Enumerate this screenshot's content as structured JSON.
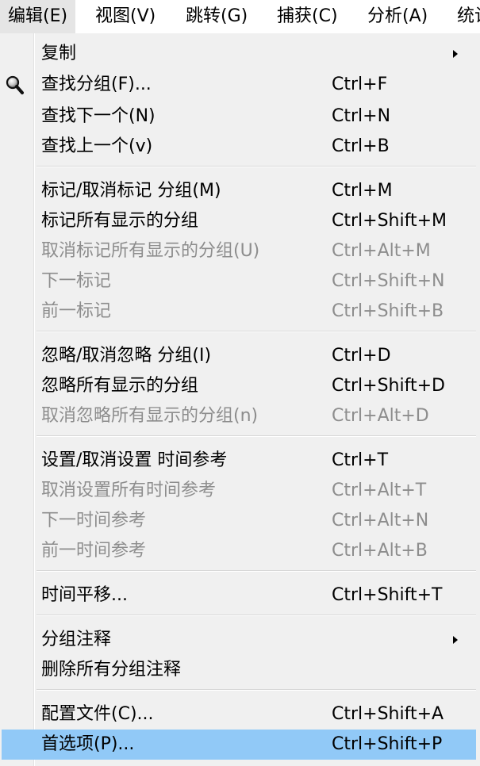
{
  "menubar": {
    "items": [
      {
        "label": "编辑(E)"
      },
      {
        "label": "视图(V)"
      },
      {
        "label": "跳转(G)"
      },
      {
        "label": "捕获(C)"
      },
      {
        "label": "分析(A)"
      },
      {
        "label": "统计"
      }
    ]
  },
  "menu": {
    "highlight_color": "#91c9f7",
    "disabled_color": "#8d8d8d",
    "items": [
      {
        "label": "复制",
        "shortcut": "",
        "submenu": true
      },
      {
        "label": "查找分组(F)...",
        "shortcut": "Ctrl+F",
        "icon": "magnifier-icon"
      },
      {
        "label": "查找下一个(N)",
        "shortcut": "Ctrl+N"
      },
      {
        "label": "查找上一个(v)",
        "shortcut": "Ctrl+B"
      },
      {
        "label": "标记/取消标记 分组(M)",
        "shortcut": "Ctrl+M"
      },
      {
        "label": "标记所有显示的分组",
        "shortcut": "Ctrl+Shift+M"
      },
      {
        "label": "取消标记所有显示的分组(U)",
        "shortcut": "Ctrl+Alt+M",
        "disabled": true
      },
      {
        "label": "下一标记",
        "shortcut": "Ctrl+Shift+N",
        "disabled": true
      },
      {
        "label": "前一标记",
        "shortcut": "Ctrl+Shift+B",
        "disabled": true
      },
      {
        "label": "忽略/取消忽略 分组(I)",
        "shortcut": "Ctrl+D"
      },
      {
        "label": "忽略所有显示的分组",
        "shortcut": "Ctrl+Shift+D"
      },
      {
        "label": "取消忽略所有显示的分组(n)",
        "shortcut": "Ctrl+Alt+D",
        "disabled": true
      },
      {
        "label": "设置/取消设置 时间参考",
        "shortcut": "Ctrl+T"
      },
      {
        "label": "取消设置所有时间参考",
        "shortcut": "Ctrl+Alt+T",
        "disabled": true
      },
      {
        "label": "下一时间参考",
        "shortcut": "Ctrl+Alt+N",
        "disabled": true
      },
      {
        "label": "前一时间参考",
        "shortcut": "Ctrl+Alt+B",
        "disabled": true
      },
      {
        "label": "时间平移...",
        "shortcut": "Ctrl+Shift+T"
      },
      {
        "label": "分组注释",
        "shortcut": "",
        "submenu": true
      },
      {
        "label": "删除所有分组注释",
        "shortcut": ""
      },
      {
        "label": "配置文件(C)...",
        "shortcut": "Ctrl+Shift+A"
      },
      {
        "label": "首选项(P)...",
        "shortcut": "Ctrl+Shift+P",
        "highlighted": true
      }
    ]
  }
}
